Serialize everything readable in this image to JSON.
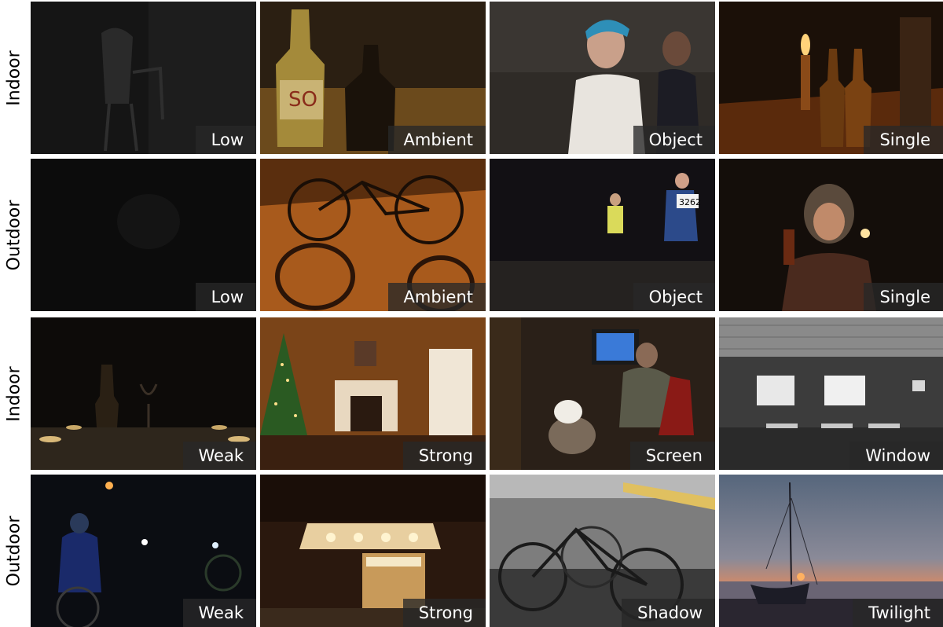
{
  "rows": [
    {
      "label": "Indoor",
      "cells": [
        "Low",
        "Ambient",
        "Object",
        "Single"
      ]
    },
    {
      "label": "Outdoor",
      "cells": [
        "Low",
        "Ambient",
        "Object",
        "Single"
      ]
    },
    {
      "label": "Indoor",
      "cells": [
        "Weak",
        "Strong",
        "Screen",
        "Window"
      ]
    },
    {
      "label": "Outdoor",
      "cells": [
        "Weak",
        "Strong",
        "Shadow",
        "Twilight"
      ]
    }
  ],
  "photos": [
    {
      "name": "chair-in-dark-room-photo"
    },
    {
      "name": "beer-bottles-photo"
    },
    {
      "name": "woman-with-bandana-photo"
    },
    {
      "name": "candle-and-bottles-photo"
    },
    {
      "name": "dark-outdoor-scene-photo"
    },
    {
      "name": "bicycle-shadow-photo"
    },
    {
      "name": "night-runners-photo"
    },
    {
      "name": "person-with-candle-photo"
    },
    {
      "name": "candlelit-table-photo"
    },
    {
      "name": "christmas-living-room-photo"
    },
    {
      "name": "man-at-computer-with-dog-photo"
    },
    {
      "name": "classroom-window-photo"
    },
    {
      "name": "night-cyclists-photo"
    },
    {
      "name": "hotel-entrance-night-photo"
    },
    {
      "name": "bicycles-shadow-street-photo"
    },
    {
      "name": "sailboat-twilight-photo"
    }
  ]
}
